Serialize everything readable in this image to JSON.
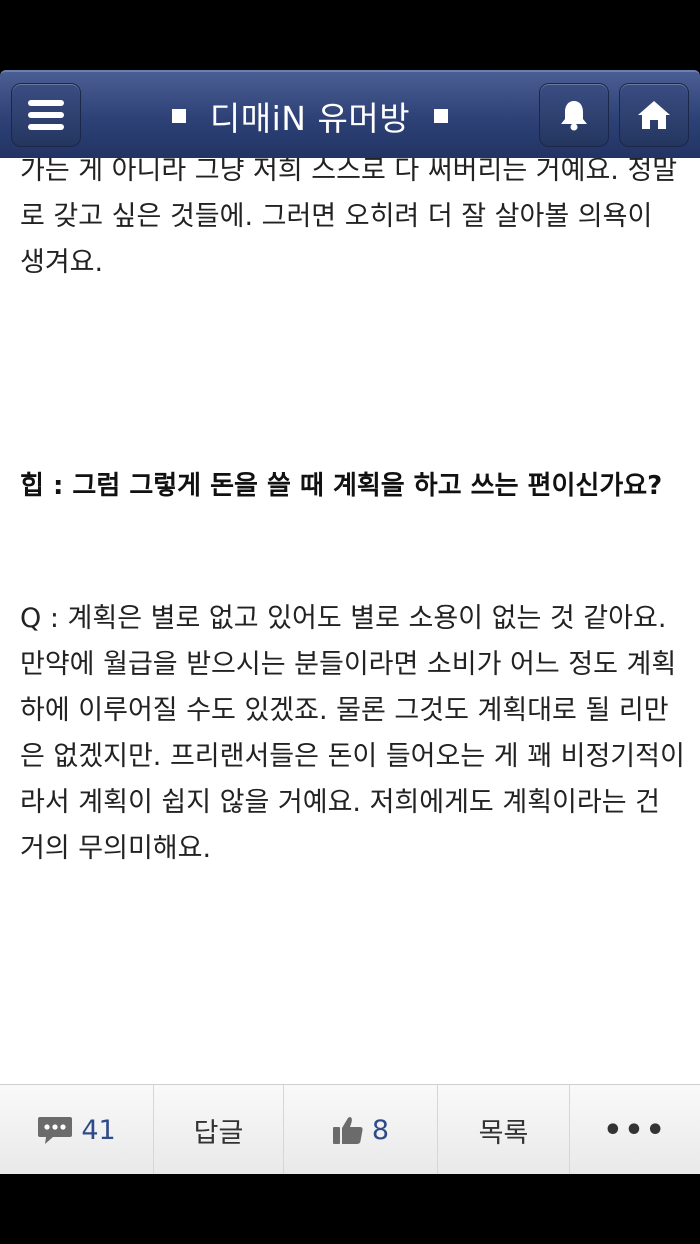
{
  "header": {
    "title": "디매iN 유머방",
    "menu_icon": "hamburger-icon",
    "bell_icon": "bell-icon",
    "home_icon": "home-icon"
  },
  "article": {
    "paragraph_1": "가는 게 아니라 그냥 저희 스스로 다 써버리는 거예요. 정말로 갖고 싶은 것들에. 그러면 오히려 더 잘 살아볼 의욕이 생겨요.",
    "question": "힙 : 그럼 그렇게 돈을 쓸 때 계획을 하고 쓰는 편이신가요?",
    "answer": "Q : 계획은 별로 없고 있어도 별로 소용이 없는 것 같아요. 만약에 월급을 받으시는 분들이라면 소비가 어느 정도 계획 하에 이루어질 수도 있겠죠. 물론 그것도 계획대로 될 리만은 없겠지만. 프리랜서들은 돈이 들어오는 게 꽤 비정기적이라서 계획이 쉽지 않을 거예요. 저희에게도 계획이라는 건 거의 무의미해요."
  },
  "bottom_bar": {
    "comment_count": "41",
    "reply_label": "답글",
    "like_count": "8",
    "list_label": "목록",
    "more_label": "•••"
  },
  "colors": {
    "header_bg": "#2d4176",
    "count_text": "#2f4a8a"
  }
}
